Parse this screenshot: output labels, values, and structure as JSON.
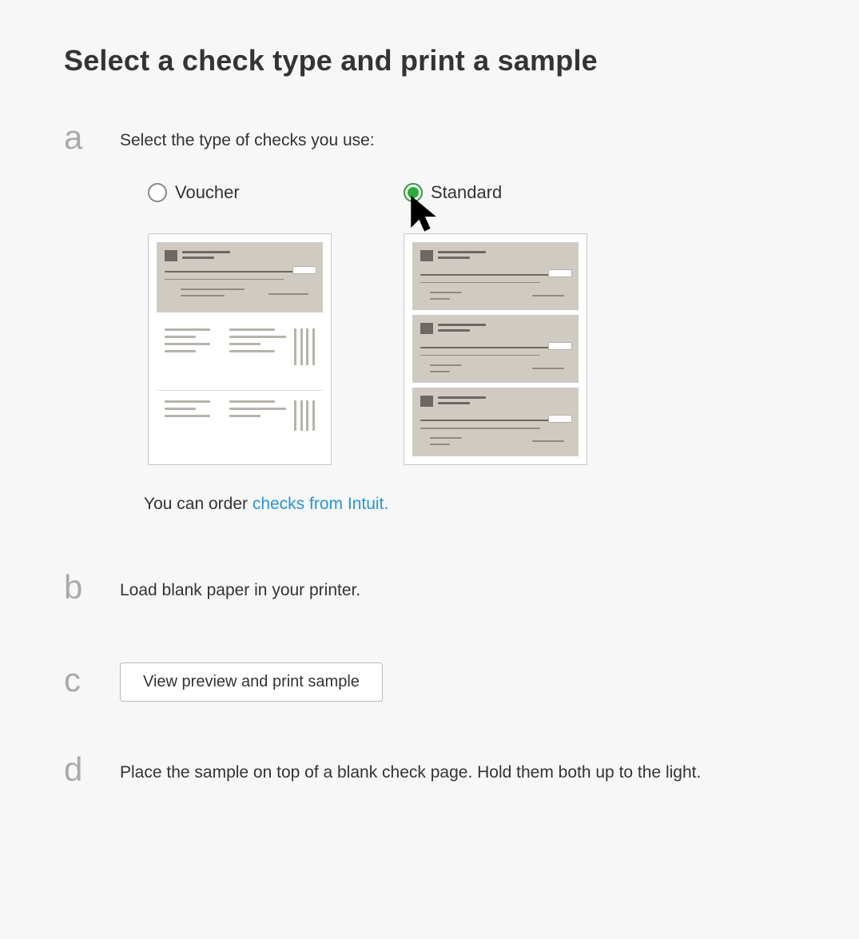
{
  "title": "Select a check type and print a sample",
  "steps": {
    "a": {
      "letter": "a",
      "instruction": "Select the type of checks you use:",
      "options": {
        "voucher": {
          "label": "Voucher",
          "selected": false
        },
        "standard": {
          "label": "Standard",
          "selected": true
        }
      },
      "order_prefix": "You can order ",
      "order_link": "checks from Intuit."
    },
    "b": {
      "letter": "b",
      "text": "Load blank paper in your printer."
    },
    "c": {
      "letter": "c",
      "button_label": "View preview and print sample"
    },
    "d": {
      "letter": "d",
      "text": "Place the sample on top of a blank check page. Hold them both up to the light."
    }
  },
  "colors": {
    "link": "#2596d1",
    "accent": "#2bab3b",
    "letter": "#aaaaaa"
  }
}
